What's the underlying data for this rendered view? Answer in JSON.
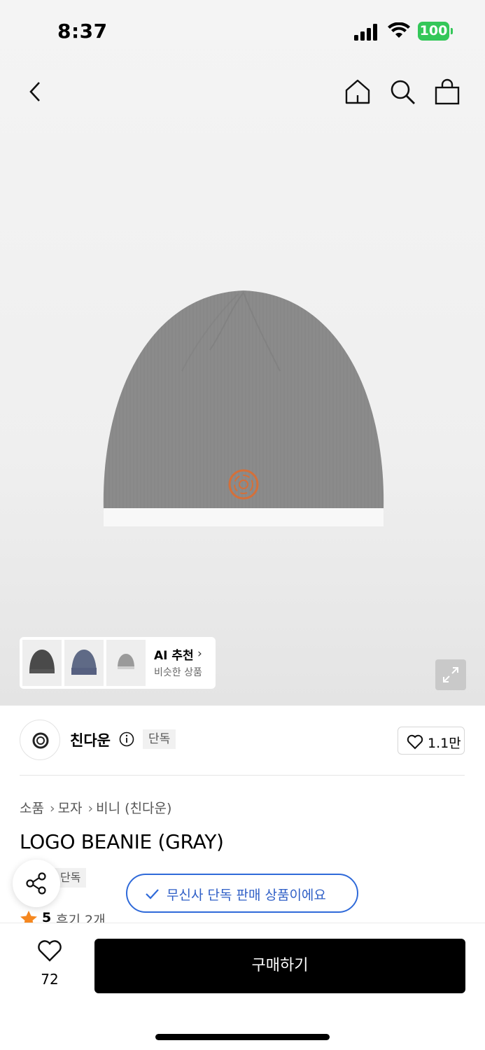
{
  "status_bar": {
    "time": "8:37",
    "battery": "100"
  },
  "header": {
    "back_icon": "chevron-left-icon",
    "home_icon": "home-icon",
    "search_icon": "search-icon",
    "bag_icon": "shopping-bag-icon"
  },
  "ai_recommend": {
    "title": "AI 추천",
    "subtitle": "비슷한 상품"
  },
  "brand": {
    "name": "친다운",
    "badge": "단독",
    "like_count": "1.1만"
  },
  "breadcrumb": [
    "소품",
    "모자",
    "비니 (친다운)"
  ],
  "product": {
    "title": "LOGO BEANIE (GRAY)",
    "badge": "단독",
    "exclusive_notice": "무신사 단독 판매 상품이에요",
    "rating": "5",
    "reviews": "후기 2개"
  },
  "bottom_bar": {
    "wish_count": "72",
    "buy_label": "구매하기"
  },
  "colors": {
    "accent_blue": "#2f6ad9",
    "star_orange": "#f5871f",
    "battery_green": "#34c759",
    "beanie_gray": "#8a8a8a"
  }
}
